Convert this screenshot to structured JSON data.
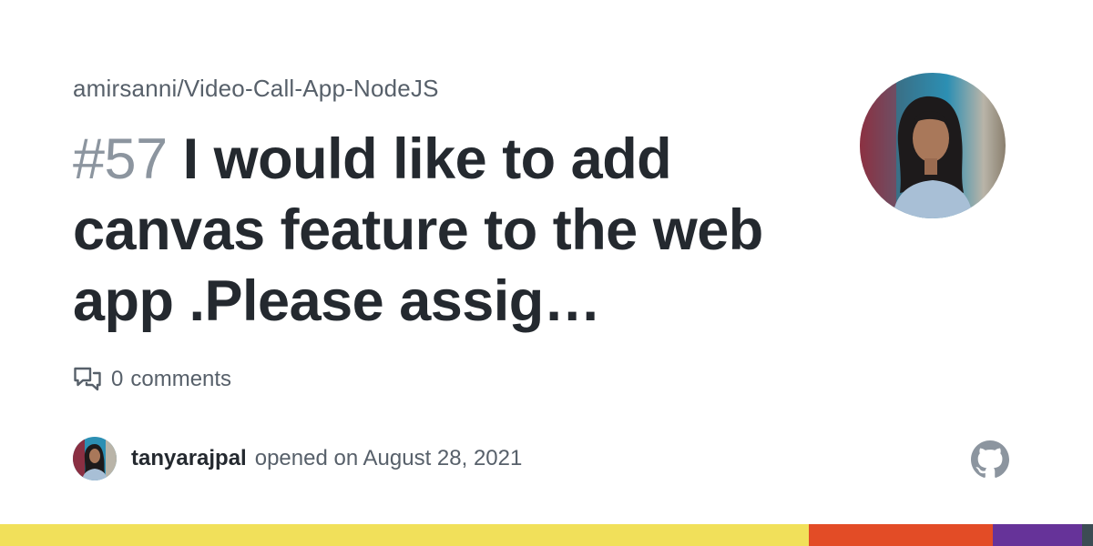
{
  "repo": "amirsanni/Video-Call-App-NodeJS",
  "issue": {
    "number": "#57",
    "title": "I would like to add canvas feature to the web app .Please assig…"
  },
  "comments": {
    "count": "0",
    "label": "comments",
    "icon": "comment-discussion-icon"
  },
  "author": {
    "username": "tanyarajpal",
    "opened_text": "opened on August 28, 2021"
  },
  "logo": "github-logo-icon",
  "language_bar": [
    {
      "color": "#f1e05a",
      "share": 0.74
    },
    {
      "color": "#e34c26",
      "share": 0.168
    },
    {
      "color": "#663399",
      "share": 0.082
    },
    {
      "color": "#3c4c54",
      "share": 0.01
    }
  ]
}
